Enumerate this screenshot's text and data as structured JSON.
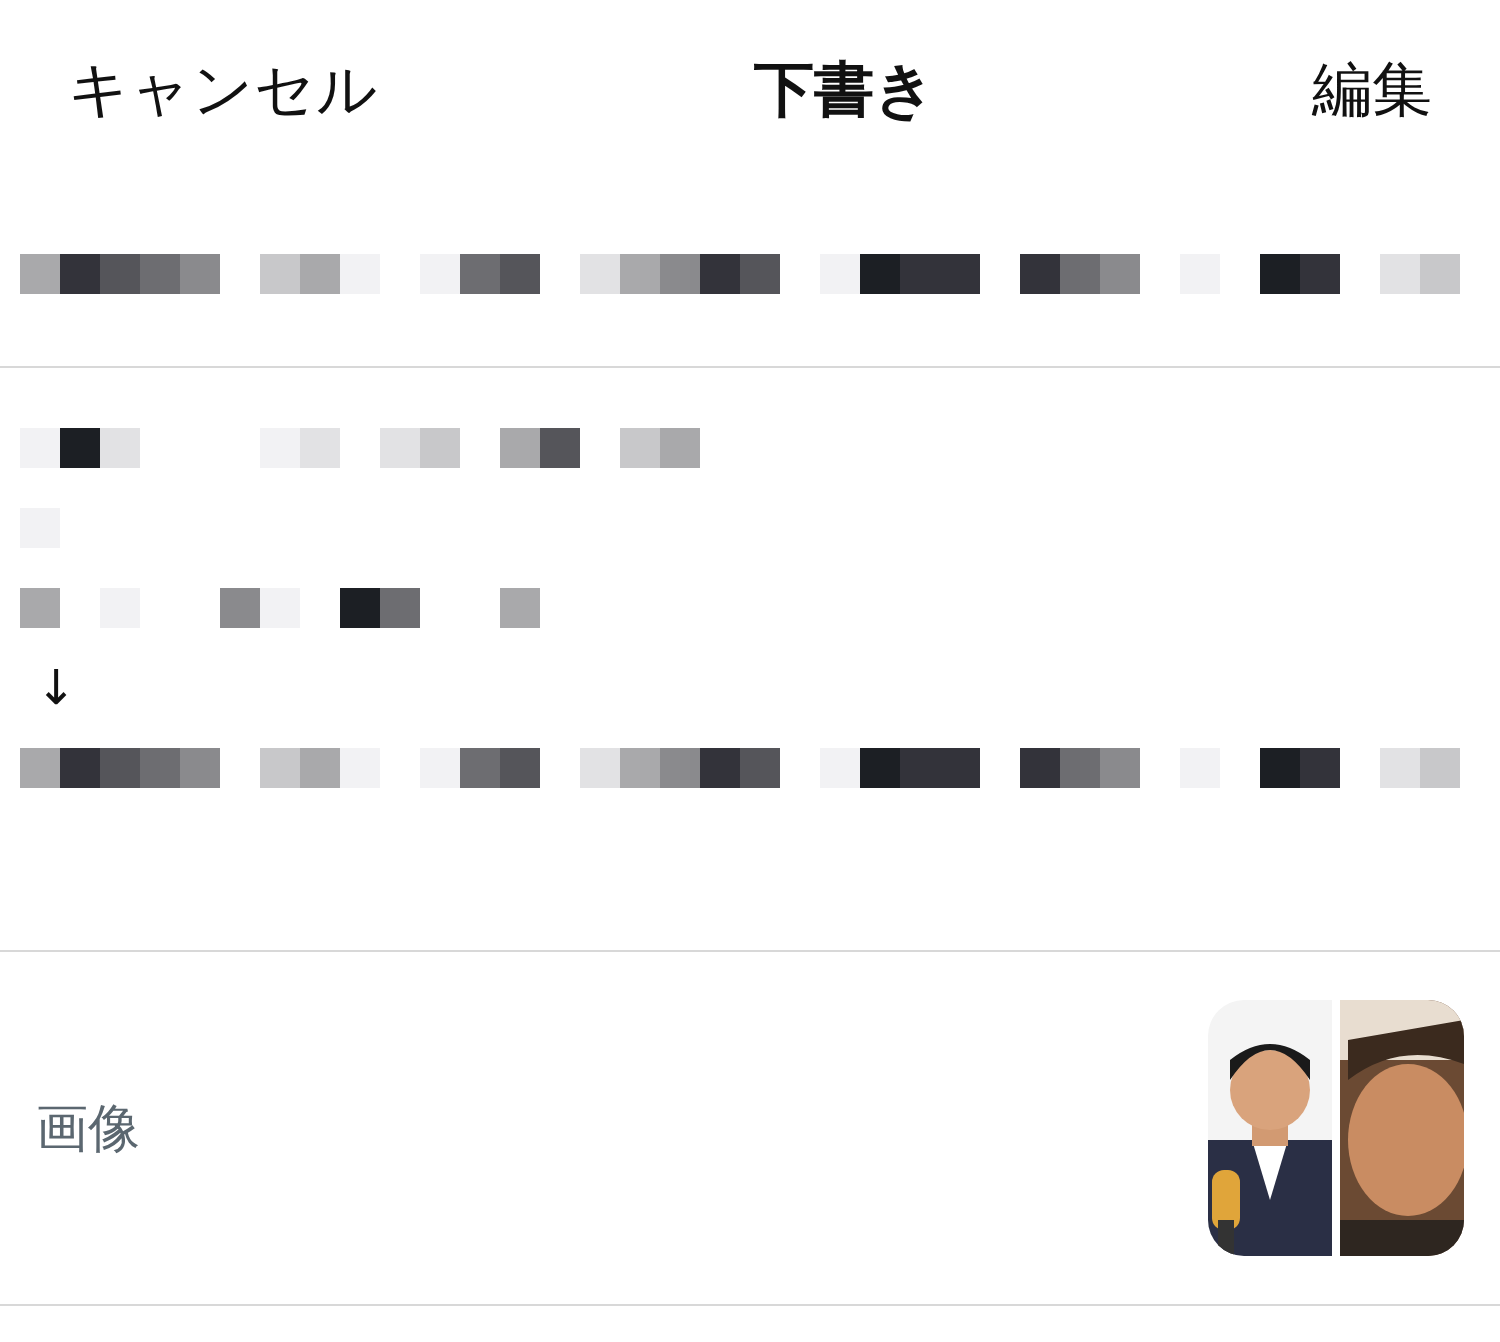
{
  "header": {
    "cancel": "キャンセル",
    "title": "下書き",
    "edit": "編集"
  },
  "subject": {
    "kind": "pixelated"
  },
  "body": [
    {
      "kind": "pixelated"
    },
    {
      "kind": "pixelated"
    },
    {
      "kind": "pixelated"
    },
    {
      "kind": "text",
      "text": "↓"
    },
    {
      "kind": "pixelated"
    }
  ],
  "attachments": {
    "label": "画像"
  }
}
